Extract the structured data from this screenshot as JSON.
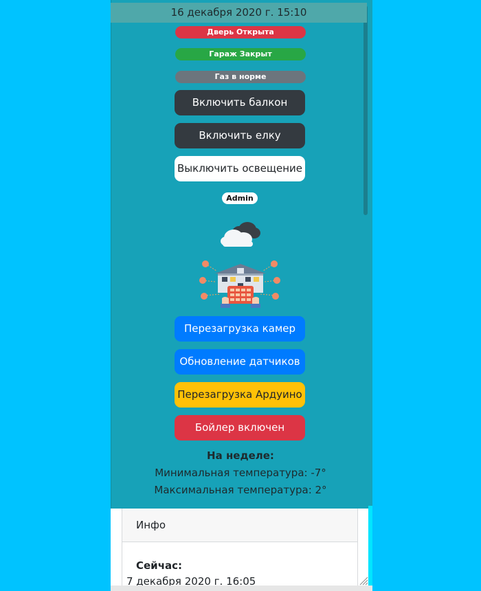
{
  "header": {
    "datetime": "16 декабря 2020 г. 15:10"
  },
  "status_badges": [
    {
      "label": "Дверь Открыта",
      "color": "#dc3545"
    },
    {
      "label": "Гараж Закрыт",
      "color": "#28a745"
    },
    {
      "label": "Газ в норме",
      "color": "#6c757d"
    }
  ],
  "controls": {
    "balcony": "Включить балкон",
    "tree": "Включить елку",
    "lights": "Выключить освещение"
  },
  "user": {
    "role": "Admin"
  },
  "icons": {
    "weather": "cloud-icon",
    "smart_home": "smart-home-illustration"
  },
  "actions": {
    "reboot_cameras": "Перезагрузка камер",
    "update_sensors": "Обновление датчиков",
    "reboot_arduino": "Перезагрузка Ардуино",
    "boiler": "Бойлер включен"
  },
  "week": {
    "title": "На неделе:",
    "min": "Минимальная температура: -7°",
    "max": "Максимальная температура: 2°"
  },
  "info": {
    "title": "Инфо",
    "now_label": "Сейчас:",
    "now_value": "7 декабря 2020 г. 16:05"
  },
  "colors": {
    "page_bg": "#00c3ff",
    "panel_bg": "#17a2b8",
    "dark": "#343a40",
    "primary": "#007bff",
    "warning": "#ffc107",
    "danger": "#dc3545",
    "success": "#28a745",
    "secondary": "#6c757d"
  }
}
